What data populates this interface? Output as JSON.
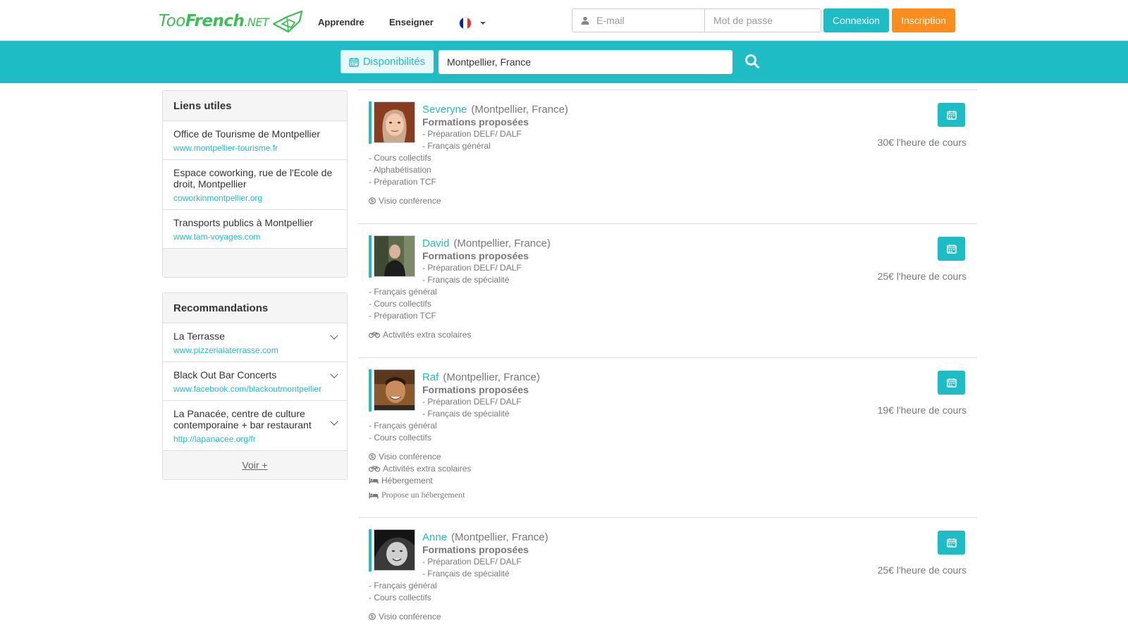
{
  "header": {
    "logo_text_a": "Too",
    "logo_text_b": "French",
    "logo_text_c": ".NET",
    "nav": [
      "Apprendre",
      "Enseigner"
    ],
    "language_flag": "fr-flag-icon",
    "email_placeholder": "E-mail",
    "password_placeholder": "Mot de passe",
    "login_label": "Connexion",
    "signup_label": "Inscription",
    "colors": {
      "accent": "#1ebdc5",
      "signup": "#fb8c1e",
      "logo": "#3dbd55"
    }
  },
  "search": {
    "availability_label": "Disponibilités",
    "location_value": "Montpellier, France"
  },
  "useful_links": {
    "title": "Liens utiles",
    "items": [
      {
        "title": "Office de Tourisme de Montpellier",
        "url": "www.montpellier-tourisme.fr"
      },
      {
        "title": "Espace coworking, rue de l'Ecole de droit, Montpellier",
        "url": "coworkinmontpellier.org"
      },
      {
        "title": "Transports publics à Montpellier",
        "url": "www.tam-voyages.com"
      }
    ]
  },
  "recommendations": {
    "title": "Recommandations",
    "items": [
      {
        "title": "La Terrasse",
        "url": "www.pizzerialaterrasse.com"
      },
      {
        "title": "Black Out Bar Concerts",
        "url": "www.facebook.com/blackoutmontpellier"
      },
      {
        "title": "La Panacée, centre de culture contemporaine + bar restaurant",
        "url": "http://lapanacee.org/fr"
      }
    ],
    "more_label": "Voir +"
  },
  "teachers": [
    {
      "name": "Severyne",
      "location": "(Montpellier, France)",
      "formations_title": "Formations proposées",
      "formations": [
        "- Préparation DELF/ DALF",
        "- Français général"
      ],
      "extra": [
        "- Cours collectifs",
        "- Alphabétisation",
        "- Préparation TCF"
      ],
      "services": [
        "Visio conférence"
      ],
      "price": "30€ l'heure de cours"
    },
    {
      "name": "David",
      "location": "(Montpellier, France)",
      "formations_title": "Formations proposées",
      "formations": [
        "- Préparation DELF/ DALF",
        "- Français de spécialité"
      ],
      "extra": [
        "- Français général",
        "- Cours collectifs",
        "- Préparation TCF"
      ],
      "services": [
        "Activités extra scolaires"
      ],
      "price": "25€ l'heure de cours"
    },
    {
      "name": "Raf",
      "location": "(Montpellier, France)",
      "formations_title": "Formations proposées",
      "formations": [
        "- Préparation DELF/ DALF",
        "- Français de spécialité"
      ],
      "extra": [
        "- Français général",
        "- Cours collectifs"
      ],
      "services": [
        "Visio conférence",
        "Activités extra scolaires",
        "Hébergement",
        "Propose un hébergement"
      ],
      "price": "19€ l'heure de cours"
    },
    {
      "name": "Anne",
      "location": "(Montpellier, France)",
      "formations_title": "Formations proposées",
      "formations": [
        "- Préparation DELF/ DALF",
        "- Français de spécialité"
      ],
      "extra": [
        "- Français général",
        "- Cours collectifs"
      ],
      "services": [
        "Visio conférence"
      ],
      "price": "25€ l'heure de cours"
    }
  ]
}
